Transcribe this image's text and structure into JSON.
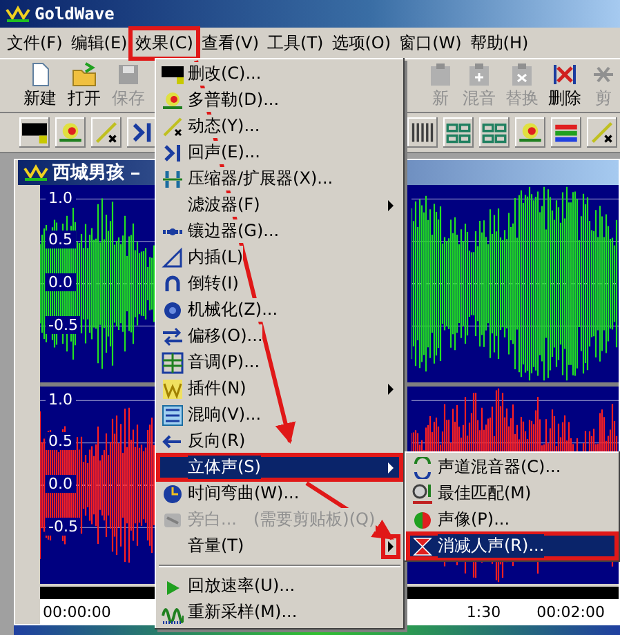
{
  "window": {
    "title": "GoldWave"
  },
  "menu_bar": [
    {
      "label": "文件(F)",
      "selected": false,
      "annotated": false
    },
    {
      "label": "编辑(E)",
      "selected": false,
      "annotated": false
    },
    {
      "label": "效果(C)",
      "selected": true,
      "annotated": true
    },
    {
      "label": "查看(V)",
      "selected": false,
      "annotated": false
    },
    {
      "label": "工具(T)",
      "selected": false,
      "annotated": false
    },
    {
      "label": "选项(O)",
      "selected": false,
      "annotated": false
    },
    {
      "label": "窗口(W)",
      "selected": false,
      "annotated": false
    },
    {
      "label": "帮助(H)",
      "selected": false,
      "annotated": false
    }
  ],
  "toolbar_left": [
    {
      "label": "新建",
      "disabled": false
    },
    {
      "label": "打开",
      "disabled": false
    },
    {
      "label": "保存",
      "disabled": true
    }
  ],
  "toolbar_right": [
    {
      "label": "新",
      "disabled": true
    },
    {
      "label": "混音",
      "disabled": true
    },
    {
      "label": "替换",
      "disabled": true
    },
    {
      "label": "删除",
      "disabled": false
    },
    {
      "label": "剪",
      "disabled": true
    }
  ],
  "document": {
    "title": "西城男孩",
    "channels": [
      {
        "color": "#22e022",
        "axis_labels": [
          "1.0",
          "0.5",
          "0.0",
          "-0.5"
        ]
      },
      {
        "color": "#ff2020",
        "axis_labels": [
          "1.0",
          "0.5",
          "0.0",
          "-0.5"
        ]
      }
    ],
    "timeline_left": [
      "00:00:00"
    ],
    "timeline_right": [
      "1:30",
      "00:02:00"
    ]
  },
  "effects_menu": {
    "items": [
      {
        "kind": "item",
        "label": "删改(C)...",
        "submenu": false,
        "selected": false,
        "disabled": false,
        "annotated": false
      },
      {
        "kind": "item",
        "label": "多普勒(D)...",
        "submenu": false,
        "selected": false,
        "disabled": false,
        "annotated": false
      },
      {
        "kind": "item",
        "label": "动态(Y)...",
        "submenu": false,
        "selected": false,
        "disabled": false,
        "annotated": false
      },
      {
        "kind": "item",
        "label": "回声(E)...",
        "submenu": false,
        "selected": false,
        "disabled": false,
        "annotated": false
      },
      {
        "kind": "item",
        "label": "压缩器/扩展器(X)...",
        "submenu": false,
        "selected": false,
        "disabled": false,
        "annotated": false
      },
      {
        "kind": "item",
        "label": "滤波器(F)",
        "submenu": true,
        "selected": false,
        "disabled": false,
        "annotated": false
      },
      {
        "kind": "item",
        "label": "镶边器(G)...",
        "submenu": false,
        "selected": false,
        "disabled": false,
        "annotated": false
      },
      {
        "kind": "item",
        "label": "内插(L)",
        "submenu": false,
        "selected": false,
        "disabled": false,
        "annotated": false
      },
      {
        "kind": "item",
        "label": "倒转(I)",
        "submenu": false,
        "selected": false,
        "disabled": false,
        "annotated": false
      },
      {
        "kind": "item",
        "label": "机械化(Z)...",
        "submenu": false,
        "selected": false,
        "disabled": false,
        "annotated": false
      },
      {
        "kind": "item",
        "label": "偏移(O)...",
        "submenu": false,
        "selected": false,
        "disabled": false,
        "annotated": false
      },
      {
        "kind": "item",
        "label": "音调(P)...",
        "submenu": false,
        "selected": false,
        "disabled": false,
        "annotated": false
      },
      {
        "kind": "item",
        "label": "插件(N)",
        "submenu": true,
        "selected": false,
        "disabled": false,
        "annotated": false
      },
      {
        "kind": "item",
        "label": "混响(V)...",
        "submenu": false,
        "selected": false,
        "disabled": false,
        "annotated": false
      },
      {
        "kind": "item",
        "label": "反向(R)",
        "submenu": false,
        "selected": false,
        "disabled": false,
        "annotated": false
      },
      {
        "kind": "item",
        "label": "立体声(S)",
        "submenu": true,
        "selected": true,
        "disabled": false,
        "annotated": true
      },
      {
        "kind": "item",
        "label": "时间弯曲(W)...",
        "submenu": false,
        "selected": false,
        "disabled": false,
        "annotated": false
      },
      {
        "kind": "item",
        "label": "旁白...",
        "note": "(需要剪贴板)(Q)",
        "submenu": false,
        "selected": false,
        "disabled": true,
        "annotated": false
      },
      {
        "kind": "item",
        "label": "音量(T)",
        "submenu": true,
        "selected": false,
        "disabled": false,
        "annotated": false,
        "arrow_annotated": true
      },
      {
        "kind": "separator"
      },
      {
        "kind": "item",
        "label": "回放速率(U)...",
        "submenu": false,
        "selected": false,
        "disabled": false,
        "annotated": false
      },
      {
        "kind": "item",
        "label": "重新采样(M)...",
        "submenu": false,
        "selected": false,
        "disabled": false,
        "annotated": false
      }
    ]
  },
  "stereo_submenu": {
    "items": [
      {
        "label": "声道混音器(C)...",
        "selected": false,
        "annotated": false
      },
      {
        "label": "最佳匹配(M)",
        "selected": false,
        "annotated": false
      },
      {
        "label": "声像(P)...",
        "selected": false,
        "annotated": false
      },
      {
        "label": "消减人声(R)...",
        "selected": true,
        "annotated": true
      }
    ]
  }
}
